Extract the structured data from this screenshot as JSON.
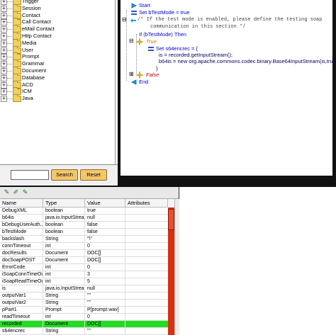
{
  "tree": {
    "items": [
      {
        "label": "Trigger"
      },
      {
        "label": "Session"
      },
      {
        "label": "Contact"
      },
      {
        "label": "Call Contact"
      },
      {
        "label": "eMail Contact"
      },
      {
        "label": "Http Contact"
      },
      {
        "label": "Media"
      },
      {
        "label": "User"
      },
      {
        "label": "Prompt"
      },
      {
        "label": "Grammar"
      },
      {
        "label": "Document"
      },
      {
        "label": "Database"
      },
      {
        "label": "ACD"
      },
      {
        "label": "ICM"
      },
      {
        "label": "Java"
      }
    ],
    "expand_glyph": "+"
  },
  "search": {
    "input_value": "",
    "search_label": "Search",
    "reset_label": "Reset"
  },
  "code": {
    "start": "Start",
    "set_btestmode": "Set bTestMode = true",
    "comment_line1": "/* If the test mode is enabled, please define the testing soap",
    "comment_line2": "communication in this section */",
    "if_line": "If (bTestMode) Then",
    "true_label": "True",
    "set_s64": "Set s64encrec = {",
    "is_line": "is = recorded.getInputStream();",
    "b64_line": "b64is = new org.apache.commons.codec.binary.Base64InputStream(is,true);",
    "close_brace": "}",
    "false_label": "False",
    "end": "End"
  },
  "variables": {
    "columns": [
      "Name",
      "Type",
      "Value",
      "Attributes"
    ],
    "rows": [
      {
        "name": "DebugXML",
        "type": "boolean",
        "value": "true",
        "attr": ""
      },
      {
        "name": "b64is",
        "type": "java.io.InputStream",
        "value": "null",
        "attr": ""
      },
      {
        "name": "bDebugUserAuth...",
        "type": "boolean",
        "value": "false",
        "attr": ""
      },
      {
        "name": "bTestMode",
        "type": "boolean",
        "value": "false",
        "attr": ""
      },
      {
        "name": "backslash",
        "type": "String",
        "value": "\"\\\"",
        "attr": ""
      },
      {
        "name": "connTimeout",
        "type": "int",
        "value": "0",
        "attr": ""
      },
      {
        "name": "docResults",
        "type": "Document",
        "value": "DOC[]",
        "attr": ""
      },
      {
        "name": "docSoapPOST",
        "type": "Document",
        "value": "DOC[]",
        "attr": ""
      },
      {
        "name": "ErrorCode",
        "type": "int",
        "value": "0",
        "attr": ""
      },
      {
        "name": "iSoapConnTimeOut",
        "type": "int",
        "value": "3",
        "attr": ""
      },
      {
        "name": "iSoapReadTimeOut",
        "type": "int",
        "value": "5",
        "attr": ""
      },
      {
        "name": "is",
        "type": "java.io.InputStream",
        "value": "null",
        "attr": ""
      },
      {
        "name": "outputVar1",
        "type": "String",
        "value": "\"\"",
        "attr": ""
      },
      {
        "name": "outputVar2",
        "type": "String",
        "value": "\"\"",
        "attr": ""
      },
      {
        "name": "pPart1",
        "type": "Prompt",
        "value": "P[prompt.wav]",
        "attr": ""
      },
      {
        "name": "readTimeout",
        "type": "int",
        "value": "0",
        "attr": ""
      },
      {
        "name": "recorded",
        "type": "Document",
        "value": "DOC[]",
        "attr": "",
        "selected": true
      },
      {
        "name": "s64encrec",
        "type": "String",
        "value": "\"\"",
        "attr": ""
      }
    ],
    "selected_color": "#22dd22"
  }
}
